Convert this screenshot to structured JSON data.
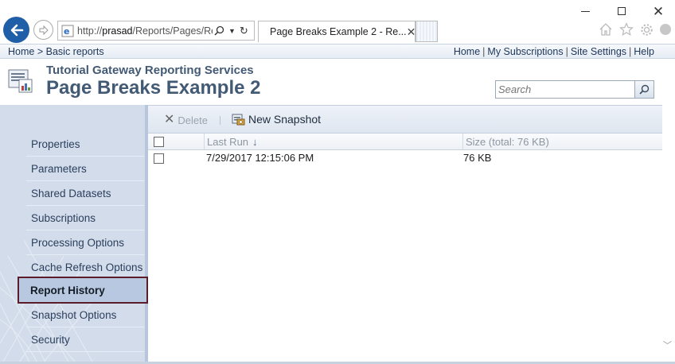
{
  "browser": {
    "address_prefix": "http://",
    "address_host": "prasad",
    "address_path": "/Reports/Pages/Re",
    "tab_title": "Page Breaks Example 2 - Re...",
    "accent_color": "#1f5fa8"
  },
  "breadcrumb": {
    "home": "Home",
    "separator": ">",
    "current": "Basic reports"
  },
  "top_links": {
    "home": "Home",
    "my_subscriptions": "My Subscriptions",
    "site_settings": "Site Settings",
    "help": "Help",
    "separator": "|"
  },
  "header": {
    "site_name": "Tutorial Gateway Reporting Services",
    "page_title": "Page Breaks Example 2",
    "search_placeholder": "Search"
  },
  "sidebar": {
    "items": [
      {
        "label": "Properties",
        "active": false
      },
      {
        "label": "Parameters",
        "active": false
      },
      {
        "label": "Shared Datasets",
        "active": false
      },
      {
        "label": "Subscriptions",
        "active": false
      },
      {
        "label": "Processing Options",
        "active": false
      },
      {
        "label": "Cache Refresh Options",
        "active": false
      },
      {
        "label": "Report History",
        "active": true
      },
      {
        "label": "Snapshot Options",
        "active": false
      },
      {
        "label": "Security",
        "active": false
      }
    ],
    "active_border_color": "#5c1d2a"
  },
  "toolbar": {
    "delete_label": "Delete",
    "new_snapshot_label": "New Snapshot"
  },
  "grid": {
    "columns": {
      "last_run": "Last Run",
      "sort_indicator": "↓",
      "size": "Size (total: 76 KB)"
    },
    "rows": [
      {
        "last_run": "7/29/2017 12:15:06 PM",
        "size": "76 KB"
      }
    ]
  }
}
